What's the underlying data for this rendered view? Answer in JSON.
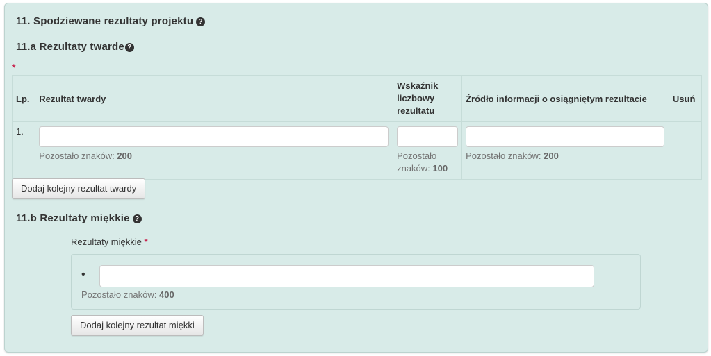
{
  "section": {
    "title": "11. Spodziewane rezultaty projektu"
  },
  "hard": {
    "title": "11.a Rezultaty twarde",
    "required_mark": "*",
    "columns": {
      "lp": "Lp.",
      "result": "Rezultat twardy",
      "indicator_line1": "Wskaźnik",
      "indicator_line2": "liczbowy",
      "indicator_line3": "rezultatu",
      "source": "Źródło informacji o osiągniętym rezultacie",
      "delete": "Usuń"
    },
    "rows": [
      {
        "lp": "1.",
        "result_value": "",
        "result_hint_label": "Pozostało znaków:",
        "result_hint_count": "200",
        "indicator_value": "",
        "indicator_hint_label1": "Pozostało",
        "indicator_hint_label2": "znaków:",
        "indicator_hint_count": "100",
        "source_value": "",
        "source_hint_label": "Pozostało znaków:",
        "source_hint_count": "200"
      }
    ],
    "add_button": "Dodaj kolejny rezultat twardy"
  },
  "soft": {
    "title": "11.b Rezultaty miękkie",
    "field_label": "Rezultaty miękkie",
    "required_mark": "*",
    "bullet": "•",
    "value": "",
    "hint_label": "Pozostało znaków:",
    "hint_count": "400",
    "add_button": "Dodaj kolejny rezultat miękki"
  },
  "icons": {
    "help": "question-circle-icon"
  },
  "colors": {
    "panel_bg": "#d8ebe8",
    "required": "#c7254e"
  }
}
